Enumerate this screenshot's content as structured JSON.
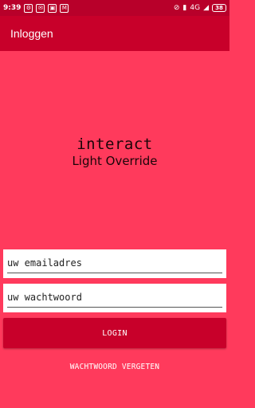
{
  "status_bar": {
    "time": "9:39",
    "network": "4G",
    "battery": "38",
    "icons": [
      "settings-icon",
      "mail-icon",
      "bag-icon",
      "gmail-icon",
      "mute-icon",
      "signal-icon",
      "battery-icon"
    ]
  },
  "app_bar": {
    "title": "Inloggen"
  },
  "logo": {
    "brand": "interact",
    "subtitle": "Light Override"
  },
  "form": {
    "email_placeholder": "uw emailadres",
    "password_placeholder": "uw wachtwoord",
    "login_label": "LOGIN",
    "forgot_label": "WACHTWOORD VERGETEN"
  },
  "colors": {
    "background": "#ff3a5c",
    "app_bar": "#c8002a",
    "status_bar": "#b8002a",
    "button": "#c8002a"
  }
}
